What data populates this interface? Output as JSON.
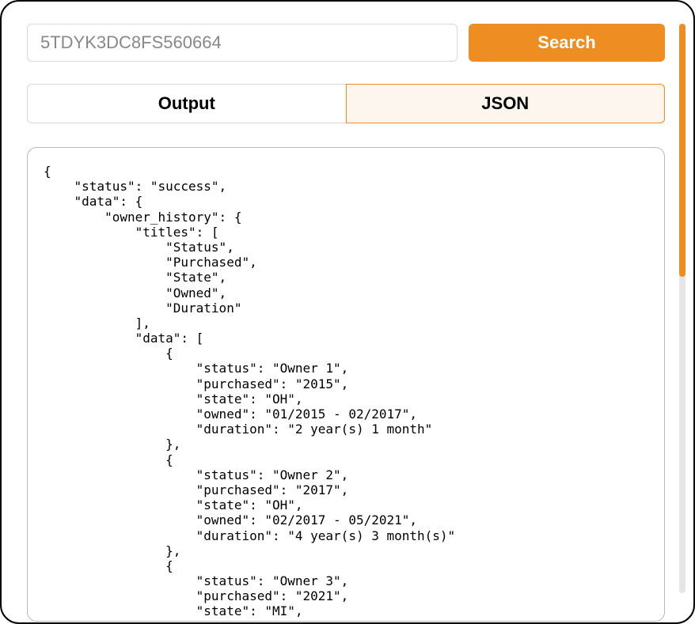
{
  "search": {
    "value": "5TDYK3DC8FS560664",
    "placeholder": "",
    "button_label": "Search"
  },
  "tabs": {
    "output_label": "Output",
    "json_label": "JSON",
    "active": "json"
  },
  "json_text": "{\n    \"status\": \"success\",\n    \"data\": {\n        \"owner_history\": {\n            \"titles\": [\n                \"Status\",\n                \"Purchased\",\n                \"State\",\n                \"Owned\",\n                \"Duration\"\n            ],\n            \"data\": [\n                {\n                    \"status\": \"Owner 1\",\n                    \"purchased\": \"2015\",\n                    \"state\": \"OH\",\n                    \"owned\": \"01/2015 - 02/2017\",\n                    \"duration\": \"2 year(s) 1 month\"\n                },\n                {\n                    \"status\": \"Owner 2\",\n                    \"purchased\": \"2017\",\n                    \"state\": \"OH\",\n                    \"owned\": \"02/2017 - 05/2021\",\n                    \"duration\": \"4 year(s) 3 month(s)\"\n                },\n                {\n                    \"status\": \"Owner 3\",\n                    \"purchased\": \"2021\",\n                    \"state\": \"MI\","
}
